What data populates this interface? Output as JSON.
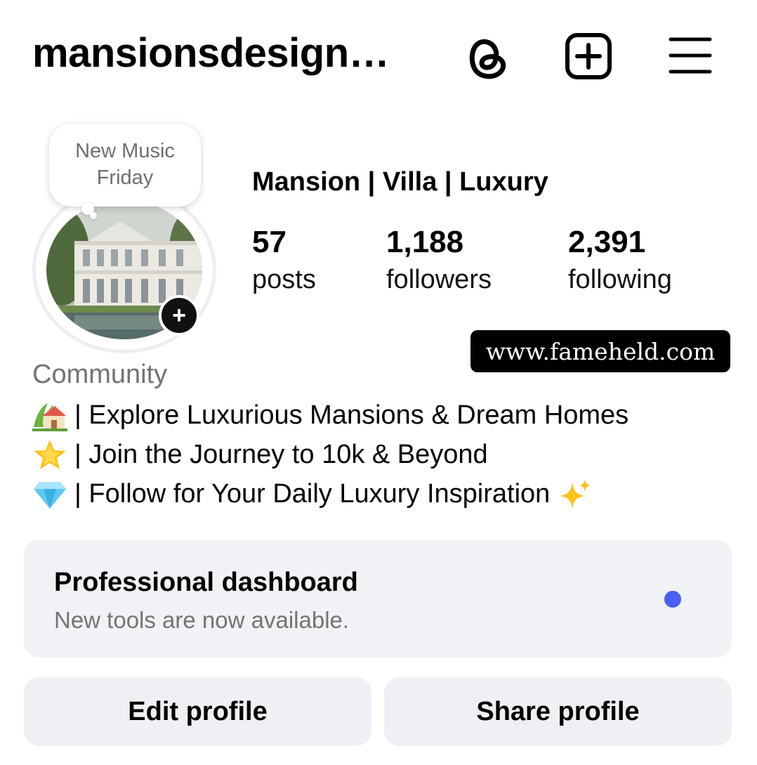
{
  "header": {
    "username": "mansionsdesign…",
    "icons": [
      "threads-icon",
      "new-post-icon",
      "menu-icon"
    ]
  },
  "note": {
    "line1": "New Music",
    "line2": "Friday"
  },
  "profile": {
    "display_name": "Mansion | Villa | Luxury"
  },
  "stats": [
    {
      "value": "57",
      "label": "posts"
    },
    {
      "value": "1,188",
      "label": "followers"
    },
    {
      "value": "2,391",
      "label": "following"
    }
  ],
  "watermark": "www.fameheld.com",
  "category": "Community",
  "bio": [
    {
      "emoji": "house-with-garden-icon",
      "text": "| Explore Luxurious Mansions & Dream Homes"
    },
    {
      "emoji": "glowing-star-icon",
      "text": "| Join the Journey to 10k & Beyond"
    },
    {
      "emoji": "gem-icon",
      "text": "| Follow for Your Daily Luxury Inspiration",
      "trailing_emoji": "sparkles-icon"
    }
  ],
  "dashboard": {
    "title": "Professional dashboard",
    "subtitle": "New tools are now available.",
    "dot_color": "#4a5ff0"
  },
  "buttons": {
    "edit": "Edit profile",
    "share": "Share profile"
  }
}
